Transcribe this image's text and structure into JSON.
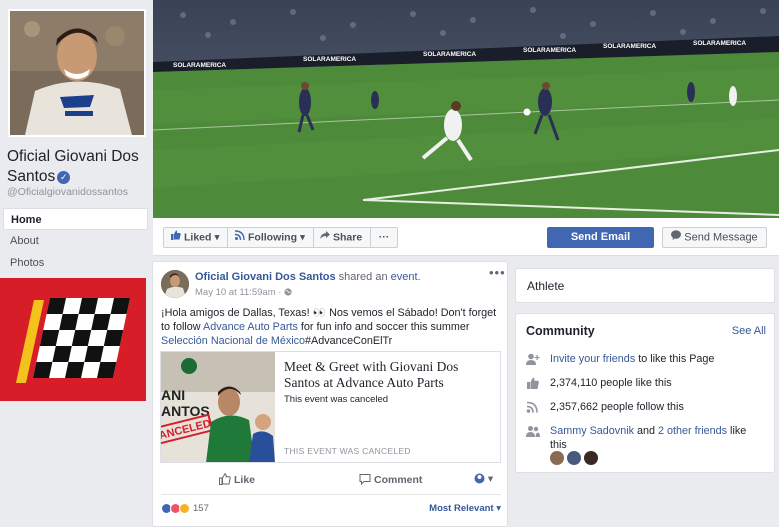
{
  "profile": {
    "name": "Oficial Giovani Dos Santos",
    "handle": "@Oficialgiovanidossantos",
    "nav": [
      "Home",
      "About",
      "Photos"
    ]
  },
  "cover": {
    "banner_text": "SOLARAMERICA"
  },
  "actions": {
    "liked": "Liked",
    "following": "Following",
    "share": "Share",
    "more": "···",
    "send_email": "Send Email",
    "send_message": "Send Message"
  },
  "post": {
    "author": "Oficial Giovani Dos Santos",
    "shared_text": " shared an ",
    "event_word": "event",
    "period": ".",
    "date": "May 10 at 11:59am · ",
    "text_intro": "¡Hola amigos de Dallas, Texas! 👀 Nos vemos el Sábado! Don't forget to follow ",
    "text_link1": "Advance Auto Parts",
    "text_mid": " for fun info and soccer this summer ",
    "text_link2": "Selección Nacional de México",
    "text_end": "#AdvanceConElTr",
    "event": {
      "title": "Meet & Greet with Giovani Dos Santos at Advance Auto Parts",
      "status": "This event was canceled",
      "canceled": "THIS EVENT WAS CANCELED",
      "img_text_top": "ANI",
      "img_text_mid": "ANTOS",
      "img_stamp": "ANCELED"
    },
    "like": "Like",
    "comment": "Comment",
    "reaction_count": "157",
    "most_relevant": "Most Relevant"
  },
  "right": {
    "category": "Athlete",
    "community_title": "Community",
    "see_all": "See All",
    "invite_link": "Invite your friends",
    "invite_rest": " to like this Page",
    "likes": "2,374,110 people like this",
    "follows": "2,357,662 people follow this",
    "friend_name": "Sammy Sadovnik",
    "friend_and": " and ",
    "friend_others": "2 other friends",
    "friend_rest": " like this"
  },
  "colors": {
    "facebook_blue": "#4267b2",
    "link": "#365899",
    "ad_red": "#d71e28",
    "pitch_green": "#4d8a3a"
  }
}
